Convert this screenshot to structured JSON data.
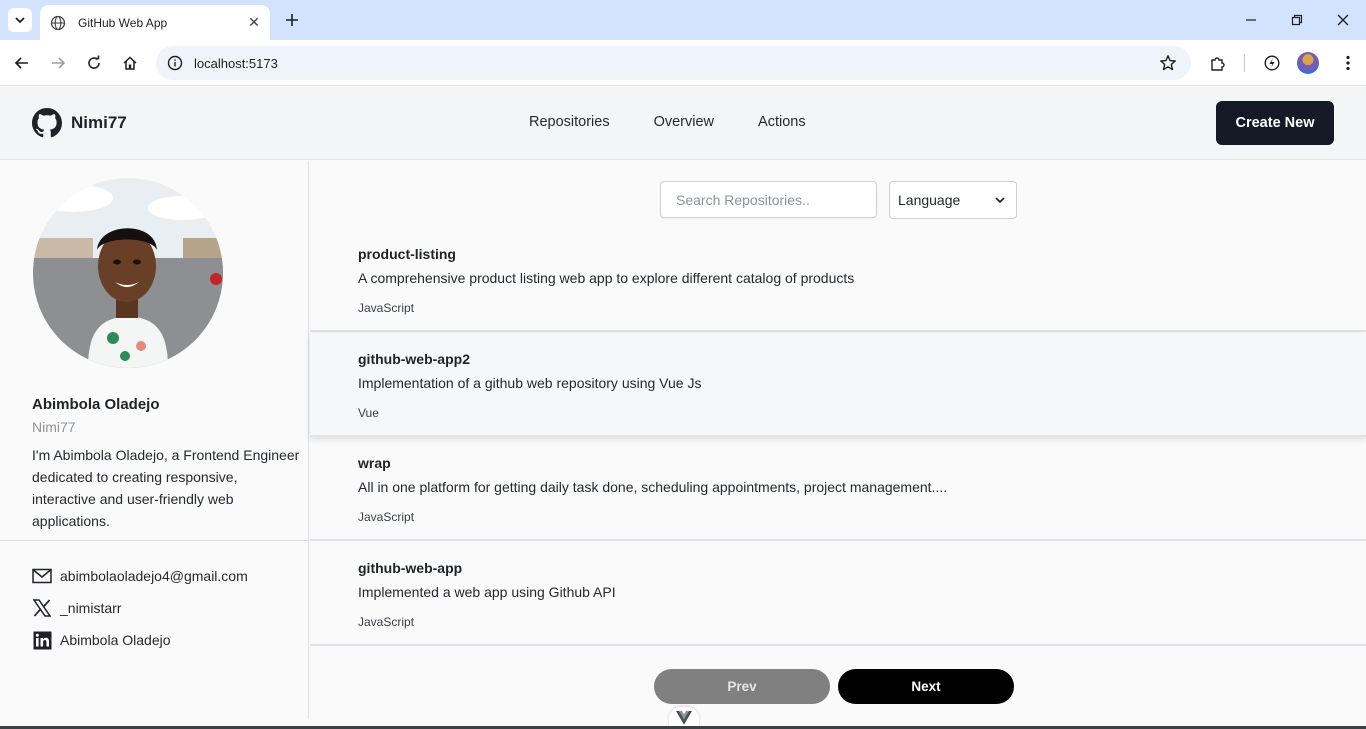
{
  "browser": {
    "tab_title": "GitHub Web App",
    "url": "localhost:5173"
  },
  "header": {
    "username": "Nimi77",
    "nav": [
      "Repositories",
      "Overview",
      "Actions"
    ],
    "create_label": "Create New"
  },
  "profile": {
    "name": "Abimbola Oladejo",
    "handle": "Nimi77",
    "bio": "I'm Abimbola Oladejo, a Frontend Engineer dedicated to creating responsive, interactive and user-friendly web applications.",
    "email": "abimbolaoladejo4@gmail.com",
    "twitter": "_nimistarr",
    "linkedin": "Abimbola Oladejo"
  },
  "search": {
    "placeholder": "Search Repositories..",
    "language_label": "Language"
  },
  "repos": [
    {
      "name": "product-listing",
      "description": "A comprehensive product listing web app to explore different catalog of products",
      "language": "JavaScript"
    },
    {
      "name": "github-web-app2",
      "description": "Implementation of a github web repository using Vue Js",
      "language": "Vue"
    },
    {
      "name": "wrap",
      "description": "All in one platform for getting daily task done, scheduling appointments, project management....",
      "language": "JavaScript"
    },
    {
      "name": "github-web-app",
      "description": "Implemented a web app using Github API",
      "language": "JavaScript"
    }
  ],
  "pagination": {
    "prev_label": "Prev",
    "next_label": "Next"
  },
  "colors": {
    "tabstrip": "#d3e3fd",
    "header_bg": "#f4f5f7",
    "create_button": "#141a26",
    "prev_button": "#808080",
    "next_button": "#000000"
  }
}
